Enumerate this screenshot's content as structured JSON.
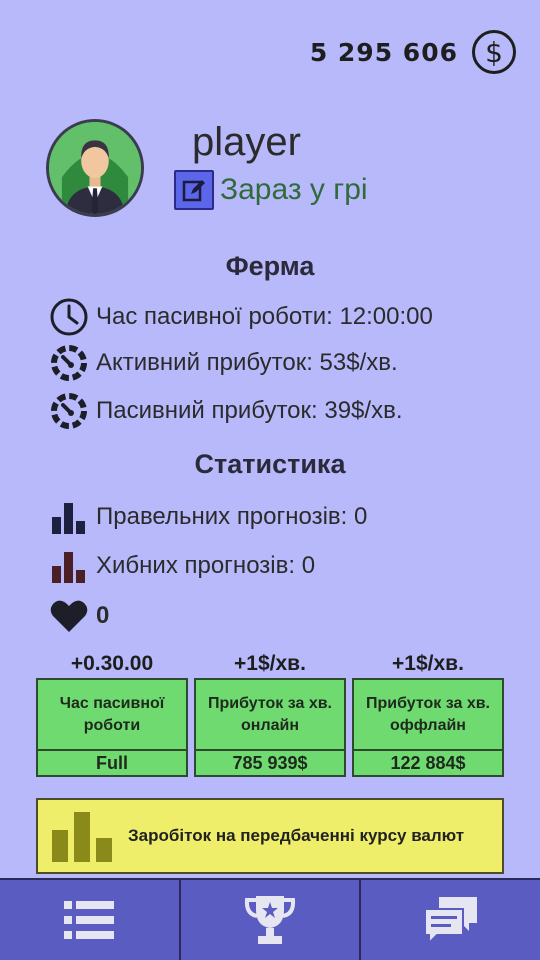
{
  "header": {
    "balance": "5 295 606",
    "currency_icon": "dollar-coin-icon"
  },
  "profile": {
    "name": "player",
    "status": "Зараз у грі"
  },
  "farm": {
    "title": "Ферма",
    "passive_time": "Час пасивної роботи: 12:00:00",
    "active_income": "Активний прибуток: 53$/хв.",
    "passive_income": "Пасивний прибуток: 39$/хв."
  },
  "stats": {
    "title": "Статистика",
    "correct": "Правельних прогнозів: 0",
    "wrong": "Хибних прогнозів: 0",
    "likes": "0"
  },
  "upgrades": [
    {
      "bonus": "+0.30.00",
      "label": "Час пасивної роботи",
      "price": "Full"
    },
    {
      "bonus": "+1$/хв.",
      "label": "Прибуток за хв. онлайн",
      "price": "785 939$"
    },
    {
      "bonus": "+1$/хв.",
      "label": "Прибуток за хв. оффлайн",
      "price": "122 884$"
    }
  ],
  "banner": {
    "text": "Заробіток на передбаченні курсу валют"
  },
  "nav": [
    "list-icon",
    "trophy-icon",
    "chat-icon"
  ],
  "colors": {
    "background": "#b7b9fb",
    "upgrade_green": "#6fda6f",
    "banner_yellow": "#eeee6a",
    "nav_blue": "#5b5cc2"
  }
}
